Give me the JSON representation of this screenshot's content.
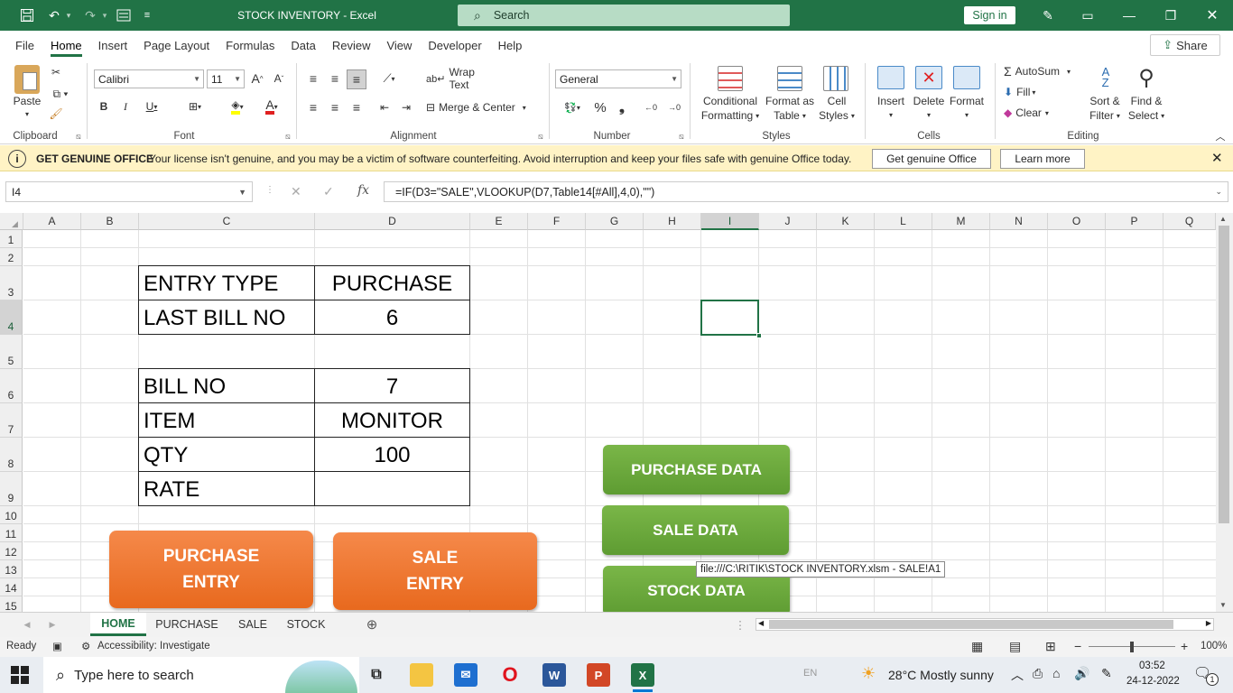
{
  "titlebar": {
    "doc_title": "STOCK INVENTORY  -  Excel",
    "search_label": "Search",
    "signin_label": "Sign in"
  },
  "ribbon_tabs": [
    "File",
    "Home",
    "Insert",
    "Page Layout",
    "Formulas",
    "Data",
    "Review",
    "View",
    "Developer",
    "Help"
  ],
  "active_tab": "Home",
  "share_label": "Share",
  "ribbon": {
    "clipboard": {
      "label": "Clipboard",
      "paste": "Paste"
    },
    "font": {
      "label": "Font",
      "family": "Calibri",
      "size": "11"
    },
    "alignment": {
      "label": "Alignment",
      "wrap_text": "Wrap Text",
      "merge_center": "Merge & Center"
    },
    "number": {
      "label": "Number",
      "format": "General"
    },
    "styles": {
      "label": "Styles",
      "conditional": "Conditional",
      "conditional2": "Formatting",
      "format_as": "Format as",
      "format_as2": "Table",
      "cell_styles": "Cell",
      "cell_styles2": "Styles"
    },
    "cells": {
      "label": "Cells",
      "insert": "Insert",
      "delete": "Delete",
      "format": "Format"
    },
    "editing": {
      "label": "Editing",
      "autosum": "AutoSum",
      "fill": "Fill",
      "clear": "Clear",
      "sort": "Sort &",
      "sort2": "Filter",
      "find": "Find &",
      "find2": "Select"
    }
  },
  "banner": {
    "title": "GET GENUINE OFFICE",
    "message": "Your license isn't genuine, and you may be a victim of software counterfeiting. Avoid interruption and keep your files safe with genuine Office today.",
    "btn_primary": "Get genuine Office",
    "btn_secondary": "Learn more"
  },
  "formula_bar": {
    "name_box": "I4",
    "formula": "=IF(D3=\"SALE\",VLOOKUP(D7,Table14[#All],4,0),\"\")"
  },
  "columns": [
    "A",
    "B",
    "C",
    "D",
    "E",
    "F",
    "G",
    "H",
    "I",
    "J",
    "K",
    "L",
    "M",
    "N",
    "O",
    "P",
    "Q"
  ],
  "selected_column": "I",
  "rows": [
    "1",
    "2",
    "3",
    "4",
    "5",
    "6",
    "7",
    "8",
    "9",
    "10",
    "11",
    "12",
    "13",
    "14",
    "15"
  ],
  "cells": {
    "c3": "ENTRY TYPE",
    "d3": "PURCHASE",
    "c4": "LAST BILL NO",
    "d4": "6",
    "c6": "BILL NO",
    "d6": "7",
    "c7": "ITEM",
    "d7": "MONITOR",
    "c8": "QTY",
    "d8": "100",
    "c9": "RATE",
    "d9": ""
  },
  "buttons": {
    "purchase_entry_1": "PURCHASE",
    "purchase_entry_2": "ENTRY",
    "sale_entry_1": "SALE",
    "sale_entry_2": "ENTRY",
    "purchase_data": "PURCHASE DATA",
    "sale_data": "SALE DATA",
    "stock_data": "STOCK DATA"
  },
  "tooltip": "file:///C:\\RITIK\\STOCK INVENTORY.xlsm - SALE!A1",
  "sheet_tabs": [
    "HOME",
    "PURCHASE",
    "SALE",
    "STOCK"
  ],
  "active_sheet": "HOME",
  "status": {
    "ready": "Ready",
    "accessibility": "Accessibility: Investigate",
    "zoom": "100%"
  },
  "taskbar": {
    "search_placeholder": "Type here to search",
    "lang": "EN",
    "weather": "28°C  Mostly sunny",
    "time": "03:52",
    "date": "24-12-2022",
    "notif_count": "1"
  },
  "colors": {
    "excel_green": "#217346",
    "orange_btn": "#ee7428",
    "green_btn": "#6aaa3c",
    "banner_bg": "#fff3c5"
  }
}
